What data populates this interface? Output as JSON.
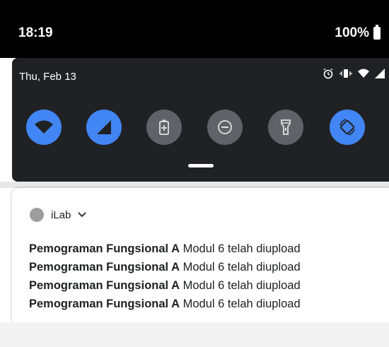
{
  "status_bar": {
    "time": "18:19",
    "battery": "100%"
  },
  "quick_settings": {
    "date": "Thu, Feb 13",
    "tiles": [
      {
        "icon": "wifi-icon",
        "state": "on"
      },
      {
        "icon": "cell-signal-icon",
        "state": "on"
      },
      {
        "icon": "battery-saver-icon",
        "state": "off"
      },
      {
        "icon": "do-not-disturb-icon",
        "state": "off"
      },
      {
        "icon": "flashlight-icon",
        "state": "off"
      },
      {
        "icon": "auto-rotate-icon",
        "state": "on"
      }
    ]
  },
  "notification": {
    "app_name": "iLab",
    "items": [
      {
        "title": "Pemograman Fungsional A",
        "text": "Modul 6 telah diupload"
      },
      {
        "title": "Pemograman Fungsional A",
        "text": "Modul 6 telah diupload"
      },
      {
        "title": "Pemograman Fungsional A",
        "text": "Modul 6 telah diupload"
      },
      {
        "title": "Pemograman Fungsional A",
        "text": "Modul 6 telah diupload"
      }
    ]
  },
  "colors": {
    "tile_on": "#4285f4",
    "tile_off": "#5f6368",
    "panel": "#202124"
  }
}
